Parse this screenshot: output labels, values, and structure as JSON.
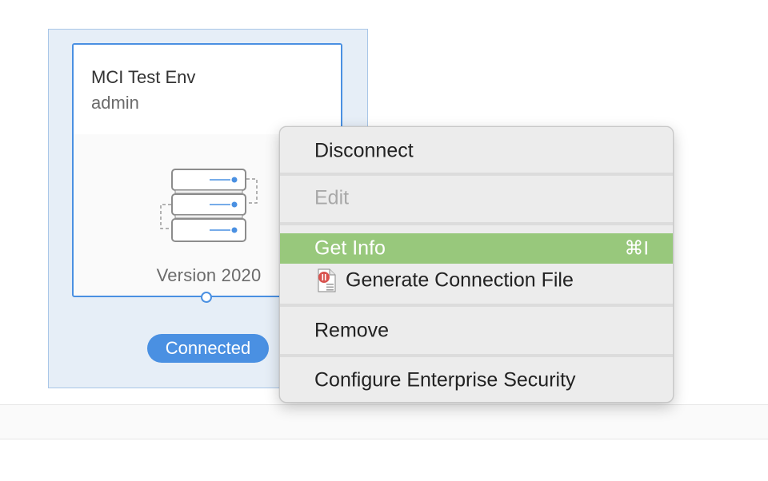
{
  "card": {
    "title": "MCI Test Env",
    "user": "admin",
    "version": "Version 2020",
    "status": "Connected",
    "icon": "server-stack-icon",
    "accent_color": "#4a90e2"
  },
  "menu": {
    "items": [
      {
        "label": "Disconnect",
        "enabled": true
      },
      {
        "label": "Edit",
        "enabled": false
      },
      {
        "label": "Get Info",
        "enabled": true,
        "highlighted": true,
        "shortcut": "⌘I"
      },
      {
        "label": "Generate Connection File",
        "enabled": true,
        "icon": "connection-file-icon"
      },
      {
        "label": "Remove",
        "enabled": true
      },
      {
        "label": "Configure Enterprise Security",
        "enabled": true
      }
    ],
    "highlight_color": "#98c87c"
  }
}
